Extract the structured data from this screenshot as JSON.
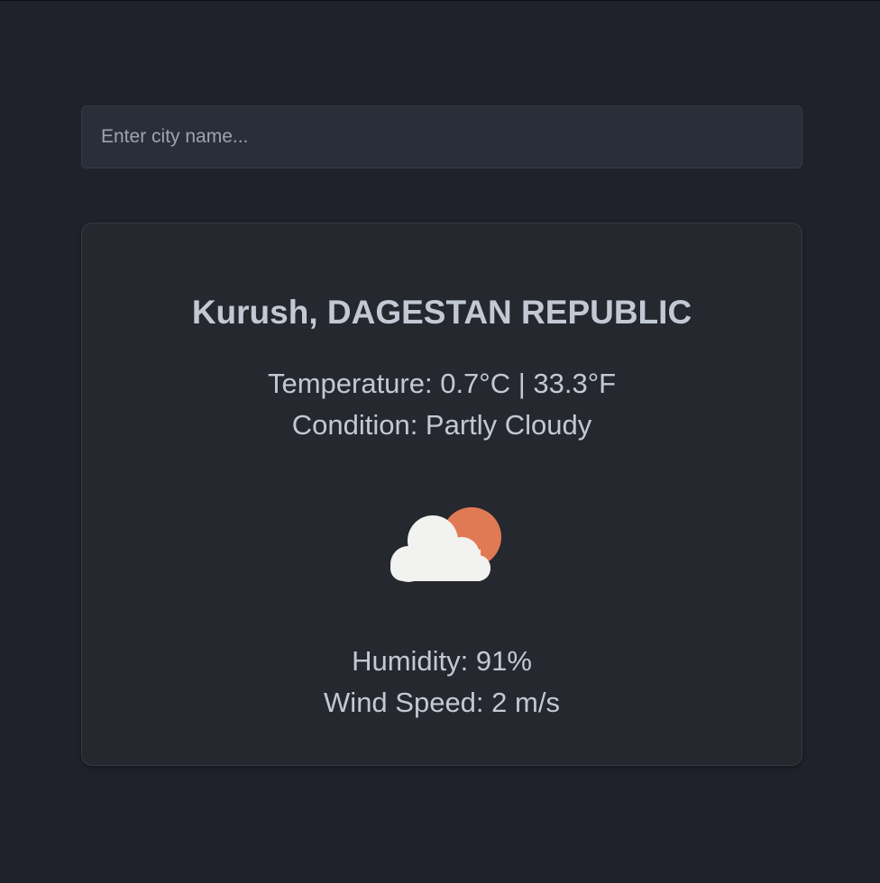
{
  "search": {
    "placeholder": "Enter city name...",
    "value": ""
  },
  "weather": {
    "location": "Kurush, DAGESTAN REPUBLIC",
    "temperature": "Temperature: 0.7°C | 33.3°F",
    "condition": "Condition: Partly Cloudy",
    "icon": "partly-cloudy-icon",
    "humidity": "Humidity: 91%",
    "wind_speed": "Wind Speed: 2 m/s"
  },
  "colors": {
    "background": "#1f222a",
    "card": "#25282e",
    "input": "#2a2e38",
    "text": "#c3c9d4",
    "sun": "#e07a55",
    "cloud": "#f2f2f0"
  }
}
